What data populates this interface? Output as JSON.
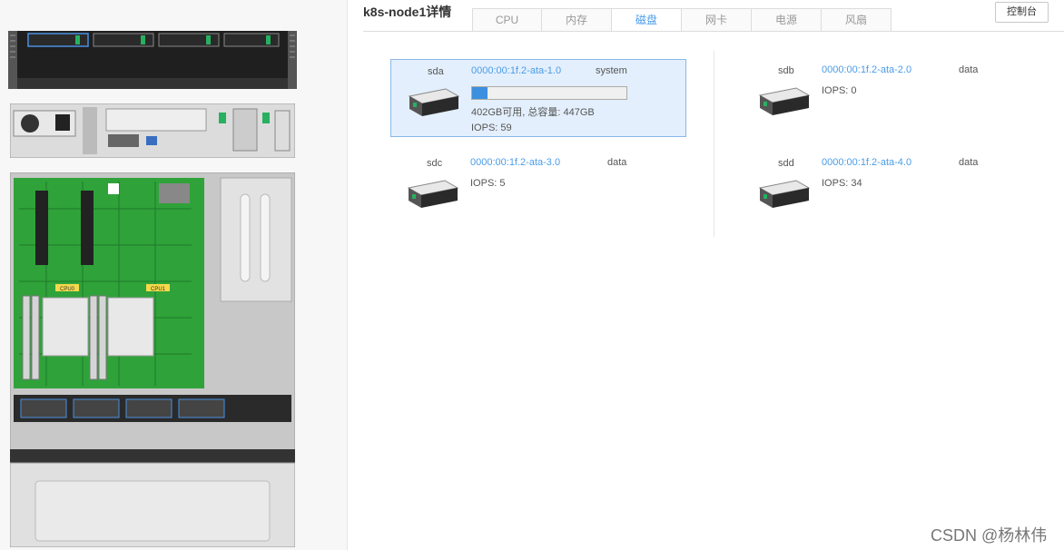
{
  "node": {
    "title": "k8s-node1详情"
  },
  "tabs": [
    {
      "label": "CPU",
      "active": false
    },
    {
      "label": "内存",
      "active": false
    },
    {
      "label": "磁盘",
      "active": true
    },
    {
      "label": "网卡",
      "active": false
    },
    {
      "label": "电源",
      "active": false
    },
    {
      "label": "风扇",
      "active": false
    }
  ],
  "toolbar": {
    "console_label": "控制台"
  },
  "disks": [
    {
      "name": "sda",
      "address": "0000:00:1f.2-ata-1.0",
      "role": "system",
      "usage_fraction": 0.1,
      "capacity": "402GB可用, 总容量: 447GB",
      "iops": "IOPS: 59",
      "selected": true
    },
    {
      "name": "sdb",
      "address": "0000:00:1f.2-ata-2.0",
      "role": "data",
      "iops": "IOPS: 0",
      "selected": false
    },
    {
      "name": "sdc",
      "address": "0000:00:1f.2-ata-3.0",
      "role": "data",
      "iops": "IOPS: 5",
      "selected": false
    },
    {
      "name": "sdd",
      "address": "0000:00:1f.2-ata-4.0",
      "role": "data",
      "iops": "IOPS: 34",
      "selected": false
    }
  ],
  "server": {
    "cpu_labels": [
      "CPU0",
      "CPU1"
    ]
  },
  "watermark": "CSDN @杨林伟",
  "colors": {
    "accent": "#4a9ce8",
    "board": "#2fa23a",
    "selected_bg": "#e3effc"
  }
}
